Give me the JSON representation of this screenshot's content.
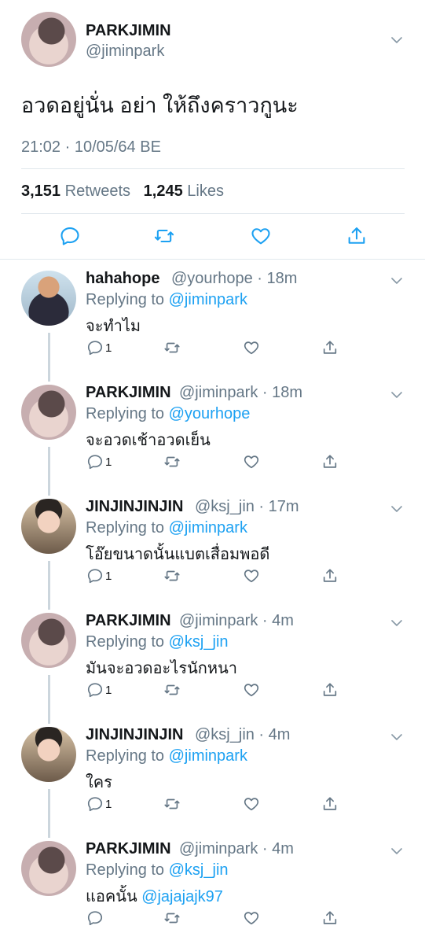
{
  "main_tweet": {
    "display_name": "PARKJIMIN",
    "handle": "@jiminpark",
    "text": "อวดอยู่นั่น อย่า ให้ถึงคราวกูนะ",
    "timestamp": "21:02 · 10/05/64 BE",
    "retweets_count": "3,151",
    "retweets_label": "Retweets",
    "likes_count": "1,245",
    "likes_label": "Likes"
  },
  "replies": [
    {
      "display_name": "hahahope",
      "handle": "@yourhope · 18m",
      "replying_prefix": "Replying to",
      "replying_to": "@jiminpark",
      "text": "จะทำไม",
      "text_mention": "",
      "reply_count": "1"
    },
    {
      "display_name": "PARKJIMIN",
      "handle": "@jiminpark · 18m",
      "replying_prefix": "Replying to",
      "replying_to": "@yourhope",
      "text": "จะอวดเช้าอวดเย็น",
      "text_mention": "",
      "reply_count": "1"
    },
    {
      "display_name": "JINJINJINJIN",
      "handle": "@ksj_jin · 17m",
      "replying_prefix": "Replying to",
      "replying_to": "@jiminpark",
      "text": "โอ๊ยขนาดนั้นแบตเสื่อมพอดี",
      "text_mention": "",
      "reply_count": "1"
    },
    {
      "display_name": "PARKJIMIN",
      "handle": "@jiminpark · 4m",
      "replying_prefix": "Replying to",
      "replying_to": "@ksj_jin",
      "text": "มันจะอวดอะไรนักหนา",
      "text_mention": "",
      "reply_count": "1"
    },
    {
      "display_name": "JINJINJINJIN",
      "handle": "@ksj_jin · 4m",
      "replying_prefix": "Replying to",
      "replying_to": "@jiminpark",
      "text": "ใคร",
      "text_mention": "",
      "reply_count": "1"
    },
    {
      "display_name": "PARKJIMIN",
      "handle": "@jiminpark · 4m",
      "replying_prefix": "Replying to",
      "replying_to": "@ksj_jin",
      "text": "แอคนั้น ",
      "text_mention": "@jajajajk97",
      "reply_count": ""
    }
  ],
  "icons": {
    "reply": "reply-icon",
    "retweet": "retweet-icon",
    "like": "heart-icon",
    "share": "share-icon",
    "menu": "chevron-down-icon"
  },
  "colors": {
    "accent": "#1da1f2",
    "secondary_text": "#657786",
    "divider": "#e1e8ed",
    "thread_line": "#ccd6dd"
  }
}
